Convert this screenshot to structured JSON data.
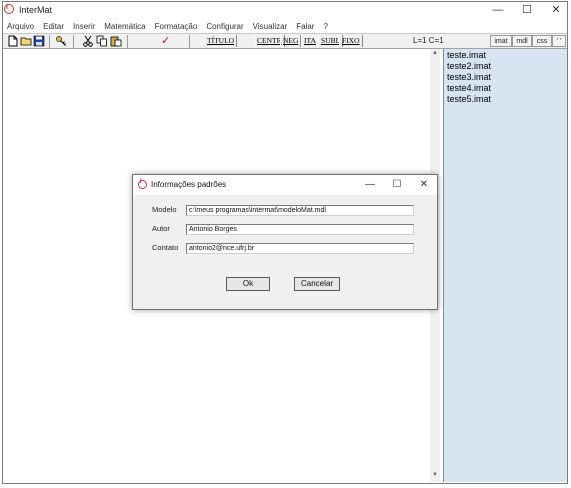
{
  "app": {
    "title": "InterMat",
    "icon_text": "I"
  },
  "window_controls": {
    "minimize": "—",
    "maximize": "☐",
    "close": "✕"
  },
  "menu": [
    "Arquivo",
    "Editar",
    "Inserir",
    "Matemática",
    "Formatação",
    "Configurar",
    "Visualizar",
    "Falar",
    "?"
  ],
  "toolbar": {
    "text_buttons": [
      "TÍTULO",
      "CENTR",
      "NEG",
      "ITA",
      "SUBL",
      "FIXO"
    ],
    "check_glyph": "✓",
    "status": "L=1  C=1",
    "tabs": [
      "imat",
      "mdl",
      "css",
      "' '"
    ]
  },
  "scroll": {
    "up": "▲",
    "down": "▼"
  },
  "files": [
    "teste.imat",
    "teste2.imat",
    "teste3.imat",
    "teste4.imat",
    "teste5.imat"
  ],
  "dialog": {
    "title": "Informações padrões",
    "icon_text": "I",
    "controls": {
      "minimize": "—",
      "maximize": "☐",
      "close": "✕"
    },
    "fields": [
      {
        "label": "Modelo",
        "value": "c:\\meus programas\\intermat\\modeloMat.mdl"
      },
      {
        "label": "Autor",
        "value": "Antonio Borges"
      },
      {
        "label": "Contato",
        "value": "antonio2@nce.ufrj.br"
      }
    ],
    "ok_label": "Ok",
    "cancel_label": "Cancelar"
  },
  "colors": {
    "file_panel_bg": "#d7e4f2",
    "check_red": "#d00000"
  }
}
